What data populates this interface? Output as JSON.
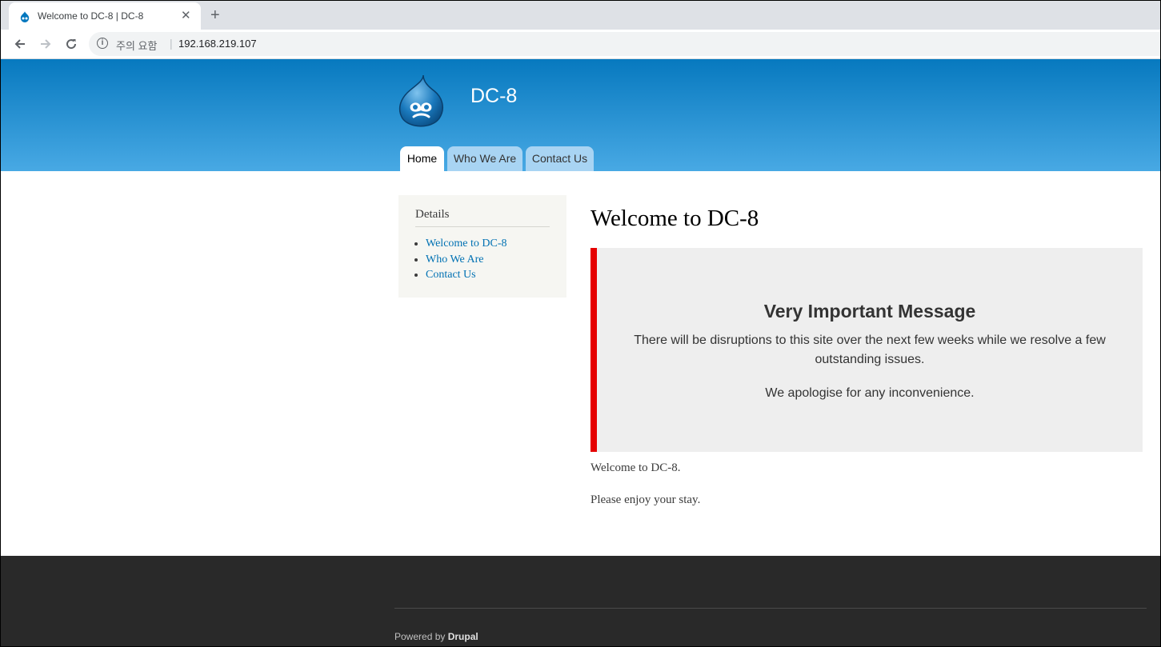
{
  "browser": {
    "tab_title": "Welcome to DC-8 | DC-8",
    "tab_close": "✕",
    "new_tab": "+",
    "security_label": "주의 요함",
    "separator": "|",
    "url": "192.168.219.107"
  },
  "header": {
    "site_name": "DC-8",
    "nav": [
      "Home",
      "Who We Are",
      "Contact Us"
    ],
    "active_tab": "Home"
  },
  "sidebar": {
    "title": "Details",
    "links": [
      "Welcome to DC-8",
      "Who We Are",
      "Contact Us"
    ]
  },
  "main": {
    "title": "Welcome to DC-8",
    "message": {
      "heading": "Very Important Message",
      "text": "There will be disruptions to this site over the next few weeks while we resolve a few outstanding issues.",
      "text2": "We apologise for any inconvenience."
    },
    "paragraphs": [
      "Welcome to DC-8.",
      "Please enjoy your stay."
    ]
  },
  "footer": {
    "powered_prefix": "Powered by ",
    "powered_link": "Drupal"
  },
  "colors": {
    "header_top": "#0779bf",
    "header_bottom": "#48a9e4",
    "link": "#0071b3",
    "alert_bar": "#e50000",
    "footer_bg": "#292929"
  }
}
